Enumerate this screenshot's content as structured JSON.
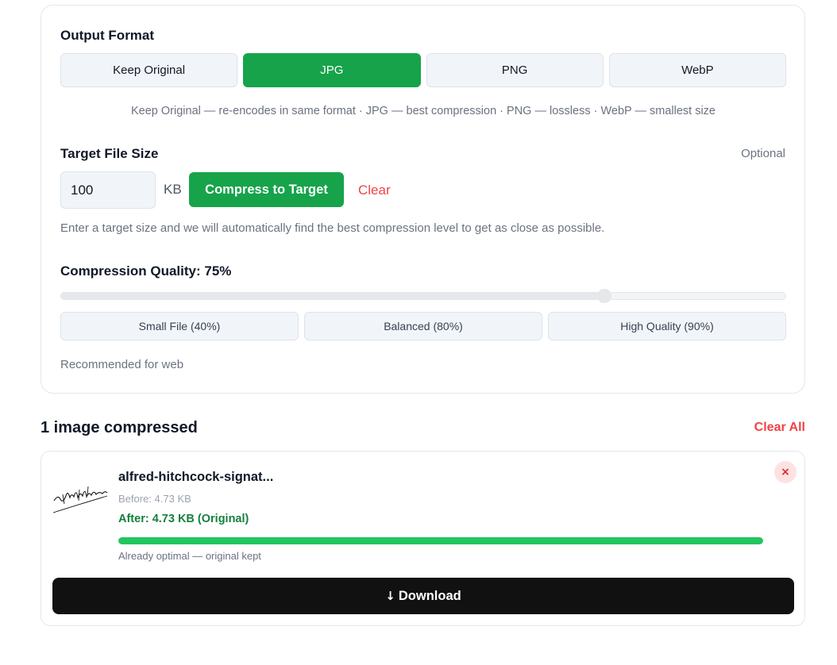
{
  "output_format": {
    "title": "Output Format",
    "options": [
      "Keep Original",
      "JPG",
      "PNG",
      "WebP"
    ],
    "selected": "JPG",
    "hint": "Keep Original — re-encodes in same format · JPG — best compression · PNG — lossless · WebP — smallest size"
  },
  "target_size": {
    "title": "Target File Size",
    "optional_label": "Optional",
    "value": "100",
    "unit": "KB",
    "compress_label": "Compress to Target",
    "clear_label": "Clear",
    "hint": "Enter a target size and we will automatically find the best compression level to get as close as possible."
  },
  "quality": {
    "title": "Compression Quality: 75%",
    "value_percent": 75,
    "presets": [
      "Small File (40%)",
      "Balanced (80%)",
      "High Quality (90%)"
    ],
    "note": "Recommended for web"
  },
  "results": {
    "title": "1 image compressed",
    "clear_all_label": "Clear All",
    "items": [
      {
        "file_name": "alfred-hitchcock-signat...",
        "before": "Before: 4.73 KB",
        "after": "After: 4.73 KB (Original)",
        "progress_percent": 100,
        "status": "Already optimal — original kept",
        "remove_label": "×",
        "download_arrow": "↓",
        "download_label": "Download"
      }
    ]
  },
  "colors": {
    "accent": "#16a34a",
    "danger": "#ef4444",
    "success_text": "#15803d",
    "progress": "#22c55e"
  },
  "icons": {
    "remove": "close-icon",
    "download": "arrow-down-icon",
    "thumbnail": "signature-thumbnail"
  }
}
